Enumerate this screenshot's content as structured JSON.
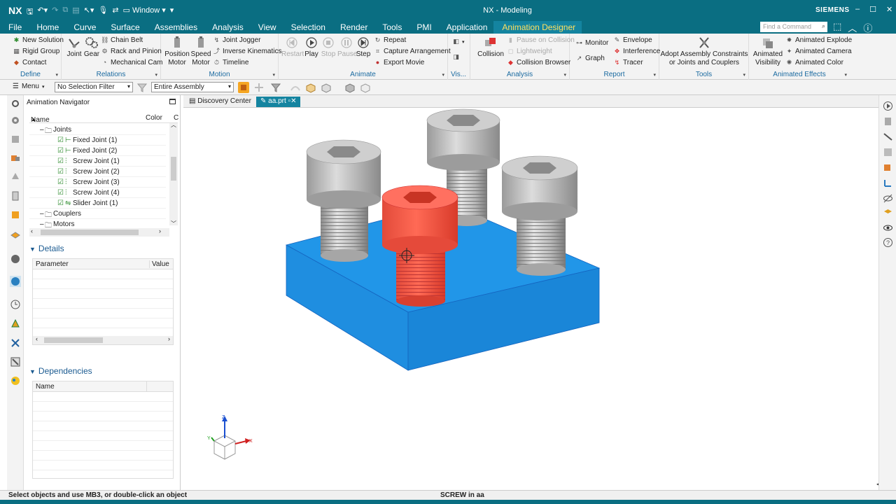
{
  "title_bar": {
    "logo": "NX",
    "window_menu": "Window",
    "window_title": "NX - Modeling",
    "brand": "SIEMENS"
  },
  "menu_tabs": [
    "File",
    "Home",
    "Curve",
    "Surface",
    "Assemblies",
    "Analysis",
    "View",
    "Selection",
    "Render",
    "Tools",
    "PMI",
    "Application",
    "Animation Designer"
  ],
  "active_tab": "Animation Designer",
  "find_command_placeholder": "Find a Command",
  "ribbon": {
    "define": {
      "label": "Define",
      "items": [
        "New Solution",
        "Rigid Group",
        "Contact"
      ]
    },
    "relations": {
      "label": "Relations",
      "big": [
        "Joint",
        "Gear"
      ],
      "items": [
        "Chain Belt",
        "Rack and Pinion",
        "Mechanical Cam"
      ]
    },
    "motion": {
      "label": "Motion",
      "big": [
        "Position\nMotor",
        "Speed\nMotor"
      ],
      "items": [
        "Joint Jogger",
        "Inverse Kinematics",
        "Timeline"
      ]
    },
    "animate": {
      "label": "Animate",
      "big": [
        "Restart",
        "Play",
        "Stop",
        "Pause",
        "Step"
      ],
      "items": [
        "Repeat",
        "Capture Arrangement",
        "Export Movie"
      ]
    },
    "vis": {
      "label": "Vis..."
    },
    "analysis": {
      "label": "Analysis",
      "big": "Collision",
      "items": [
        "Pause on Collision",
        "Lightweight",
        "Collision Browser"
      ]
    },
    "report": {
      "label": "Report",
      "items": [
        "Monitor",
        "Graph",
        "Envelope",
        "Interference",
        "Tracer"
      ]
    },
    "tools": {
      "label": "Tools",
      "big": "Adopt Assembly Constraints\nor Joints and Couplers"
    },
    "effects": {
      "label": "Animated Effects",
      "big": "Animated\nVisibility",
      "items": [
        "Animated Explode",
        "Animated Camera",
        "Animated Color"
      ]
    }
  },
  "toolbar": {
    "menu_label": "Menu",
    "selection_filter": "No Selection Filter",
    "scope": "Entire Assembly"
  },
  "navigator": {
    "title": "Animation Navigator",
    "columns": [
      "Name",
      "Color",
      "C"
    ],
    "rows": [
      {
        "label": "Joints",
        "type": "folder",
        "indent": 0
      },
      {
        "label": "Fixed Joint (1)",
        "type": "fixed",
        "indent": 1
      },
      {
        "label": "Fixed Joint (2)",
        "type": "fixed",
        "indent": 1
      },
      {
        "label": "Screw Joint (1)",
        "type": "screw",
        "indent": 1
      },
      {
        "label": "Screw Joint (2)",
        "type": "screw",
        "indent": 1
      },
      {
        "label": "Screw Joint (3)",
        "type": "screw",
        "indent": 1
      },
      {
        "label": "Screw Joint (4)",
        "type": "screw",
        "indent": 1
      },
      {
        "label": "Slider Joint (1)",
        "type": "slider",
        "indent": 1
      },
      {
        "label": "Couplers",
        "type": "folder",
        "indent": 0
      },
      {
        "label": "Motors",
        "type": "folder",
        "indent": 0
      }
    ],
    "details": {
      "title": "Details",
      "columns": [
        "Parameter",
        "Value"
      ]
    },
    "dependencies": {
      "title": "Dependencies",
      "columns": [
        "Name"
      ]
    }
  },
  "viewport": {
    "tabs": [
      "Discovery Center",
      "aa.prt"
    ],
    "active_tab": "aa.prt",
    "axes": {
      "x": "X",
      "y": "Y",
      "z": "Z"
    }
  },
  "status": {
    "prompt": "Select objects and use MB3, or double-click an object",
    "selection": "SCREW in aa"
  },
  "colors": {
    "title_bar": "#0a6e82",
    "active_tab_text": "#ffe060",
    "block": "#1e88e5",
    "selected_screw": "#e53935",
    "screw_gray": "#b8b8b8"
  }
}
